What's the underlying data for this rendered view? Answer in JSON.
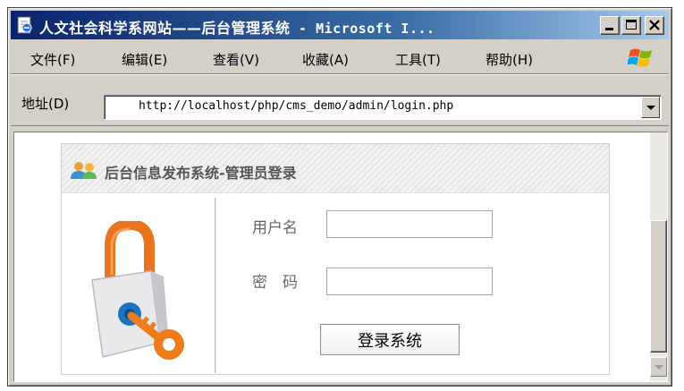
{
  "window": {
    "title_cn": "人文社会科学系网站——后台管理系统",
    "title_sep": " - ",
    "title_app": "Microsoft I..."
  },
  "menu": {
    "items": [
      "文件(F)",
      "编辑(E)",
      "查看(V)",
      "收藏(A)",
      "工具(T)",
      "帮助(H)"
    ]
  },
  "address": {
    "label": "地址(D)",
    "url": "http://localhost/php/cms_demo/admin/login.php"
  },
  "panel": {
    "title": "后台信息发布系统-管理员登录"
  },
  "form": {
    "username_label": "用户名",
    "username_value": "",
    "password_label": "密　码",
    "password_value": "",
    "submit_label": "登录系统"
  },
  "colors": {
    "titlebar_start": "#0a246a",
    "titlebar_end": "#a6caf0",
    "window_face": "#d4d0c8",
    "lock_orange": "#f07b1b",
    "lock_blue": "#1e73be"
  },
  "icons": {
    "window": "ie-page-icon",
    "branding": "windows-flag-icon",
    "panel": "users-icon",
    "illustration": "lock-key-icon"
  }
}
